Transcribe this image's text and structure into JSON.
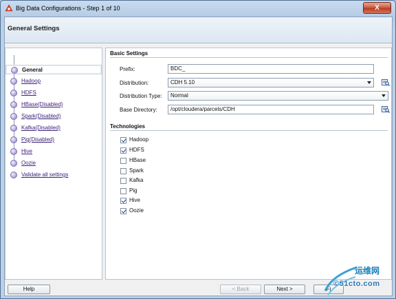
{
  "window": {
    "title": "Big Data Configurations - Step 1 of 10",
    "close_symbol": "X"
  },
  "header": {
    "title": "General Settings"
  },
  "nav": {
    "items": [
      {
        "label": "General",
        "selected": true
      },
      {
        "label": "Hadoop",
        "selected": false
      },
      {
        "label": "HDFS",
        "selected": false
      },
      {
        "label": "HBase(Disabled)",
        "selected": false
      },
      {
        "label": "Spark(Disabled)",
        "selected": false
      },
      {
        "label": "Kafka(Disabled)",
        "selected": false
      },
      {
        "label": "Pig(Disabled)",
        "selected": false
      },
      {
        "label": "Hive",
        "selected": false
      },
      {
        "label": "Oozie",
        "selected": false
      },
      {
        "label": "Validate all settings",
        "selected": false
      }
    ]
  },
  "basic_settings": {
    "section_title": "Basic Settings",
    "prefix_label": "Prefix:",
    "prefix_value": "BDC_",
    "distribution_label": "Distribution:",
    "distribution_value": "CDH 5.10",
    "distribution_type_label": "Distribution Type:",
    "distribution_type_value": "Normal",
    "base_directory_label": "Base Directory:",
    "base_directory_value": "/opt/cloudera/parcels/CDH"
  },
  "technologies": {
    "section_title": "Technologies",
    "items": [
      {
        "label": "Hadoop",
        "checked": true
      },
      {
        "label": "HDFS",
        "checked": true
      },
      {
        "label": "HBase",
        "checked": false
      },
      {
        "label": "Spark",
        "checked": false
      },
      {
        "label": "Kafka",
        "checked": false
      },
      {
        "label": "Pig",
        "checked": false
      },
      {
        "label": "Hive",
        "checked": true
      },
      {
        "label": "Oozie",
        "checked": true
      }
    ]
  },
  "buttons": {
    "help": "Help",
    "back": "< Back",
    "next": "Next >",
    "finish_partial": "Fi"
  },
  "watermark": {
    "top": "运维网",
    "bottom": "©51cto.com"
  },
  "colors": {
    "nav_link": "#3b1f78",
    "close_red": "#c95a3f",
    "watermark_blue": "#1b7fb7"
  }
}
